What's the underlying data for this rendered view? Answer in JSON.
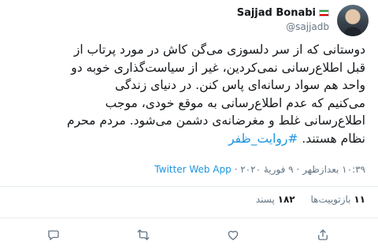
{
  "author": {
    "display_name": "Sajjad Bonabi",
    "handle": "@sajjadb",
    "flag_colors": [
      "#239f40",
      "#ffffff",
      "#da0000"
    ]
  },
  "tweet": {
    "text_lines": [
      "دوستانی که از سر دلسوزی می‌گن کاش در مورد پرتاب از",
      "قبل اطلاع‌رسانی نمی‌کردین، غیر از سیاست‌گذاری خوبه دو",
      "واحد هم سواد رسانه‌ای پاس کنن. در دنیای زندگی",
      "می‌کنیم که عدم اطلاع‌رسانی به موقع خودی، موجب",
      "اطلاع‌رسانی غلط و مغرضانه‌ی دشمن می‌شود. مردم محرم"
    ],
    "last_line_text": "نظام هستند.",
    "hashtag": "#روایت_ظفر"
  },
  "meta": {
    "time": "۱۰:۳۹ بعدازظهر",
    "separator": "·",
    "date": "۹ فوریهٔ ۲۰۲۰",
    "source": "Twitter Web App"
  },
  "stats": {
    "retweets_count": "۱۱",
    "retweets_label": "بازتوییت‌ها",
    "likes_count": "۱۸۲",
    "likes_label": "پسند"
  },
  "actions": [
    "reply-icon",
    "retweet-icon",
    "like-icon",
    "share-icon"
  ],
  "colors": {
    "link": "#1b95e0",
    "secondary": "#657786",
    "text": "#14171a",
    "divider": "#e6ecf0"
  }
}
